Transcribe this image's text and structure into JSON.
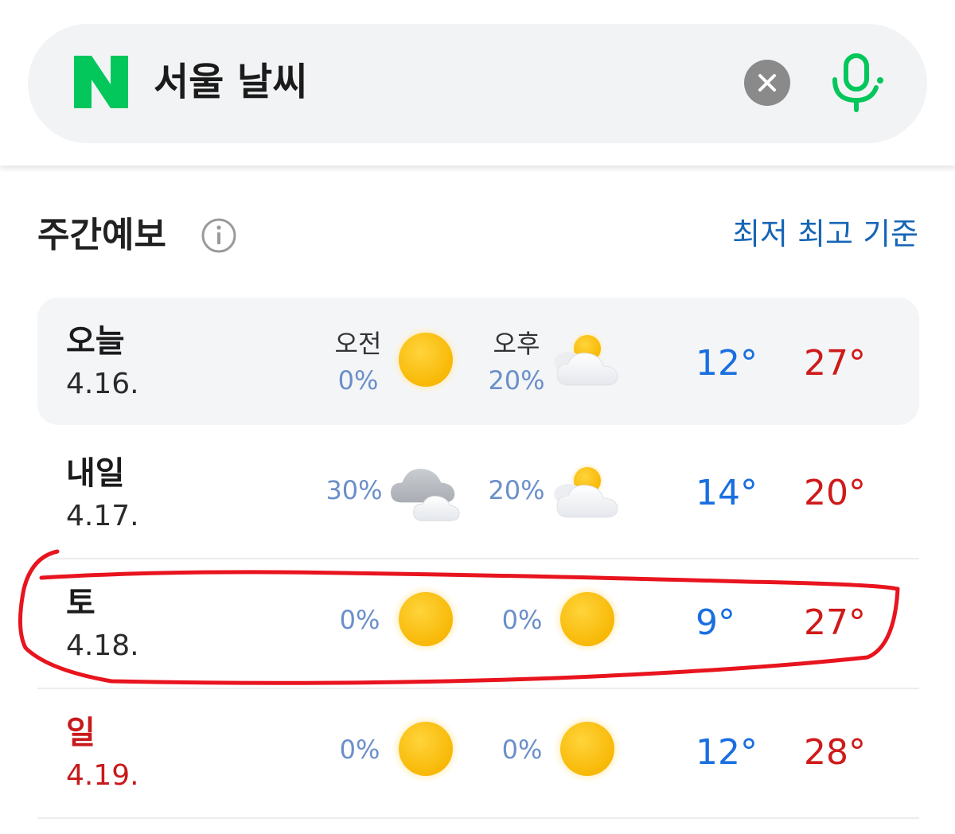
{
  "search": {
    "logo": "N",
    "query": "서울 날씨",
    "clear_icon": "close-icon",
    "mic_icon": "microphone-icon",
    "brand_color": "#03c75a"
  },
  "section": {
    "title": "주간예보",
    "info_icon": "info-icon",
    "sort_link": "최저 최고 기준"
  },
  "forecast": [
    {
      "day": "오늘",
      "date": "4.16.",
      "am_label": "오전",
      "am_precip": "0%",
      "am_icon": "sun-icon",
      "pm_label": "오후",
      "pm_precip": "20%",
      "pm_icon": "partly-cloudy-icon",
      "min": "12°",
      "max": "27°"
    },
    {
      "day": "내일",
      "date": "4.17.",
      "am_precip": "30%",
      "am_icon": "cloudy-icon",
      "pm_precip": "20%",
      "pm_icon": "partly-cloudy-icon",
      "min": "14°",
      "max": "20°"
    },
    {
      "day": "토",
      "date": "4.18.",
      "am_precip": "0%",
      "am_icon": "sun-icon",
      "pm_precip": "0%",
      "pm_icon": "sun-icon",
      "min": "9°",
      "max": "27°",
      "highlighted": true
    },
    {
      "day": "일",
      "date": "4.19.",
      "am_precip": "0%",
      "am_icon": "sun-icon",
      "pm_precip": "0%",
      "pm_icon": "sun-icon",
      "min": "12°",
      "max": "28°",
      "weekend_color": "#c8191b"
    }
  ],
  "colors": {
    "min_temp": "#1a6fe0",
    "max_temp": "#cf1a1a",
    "precip": "#6b8fc9",
    "link": "#1765b6",
    "highlight_marker": "#e8141e"
  }
}
